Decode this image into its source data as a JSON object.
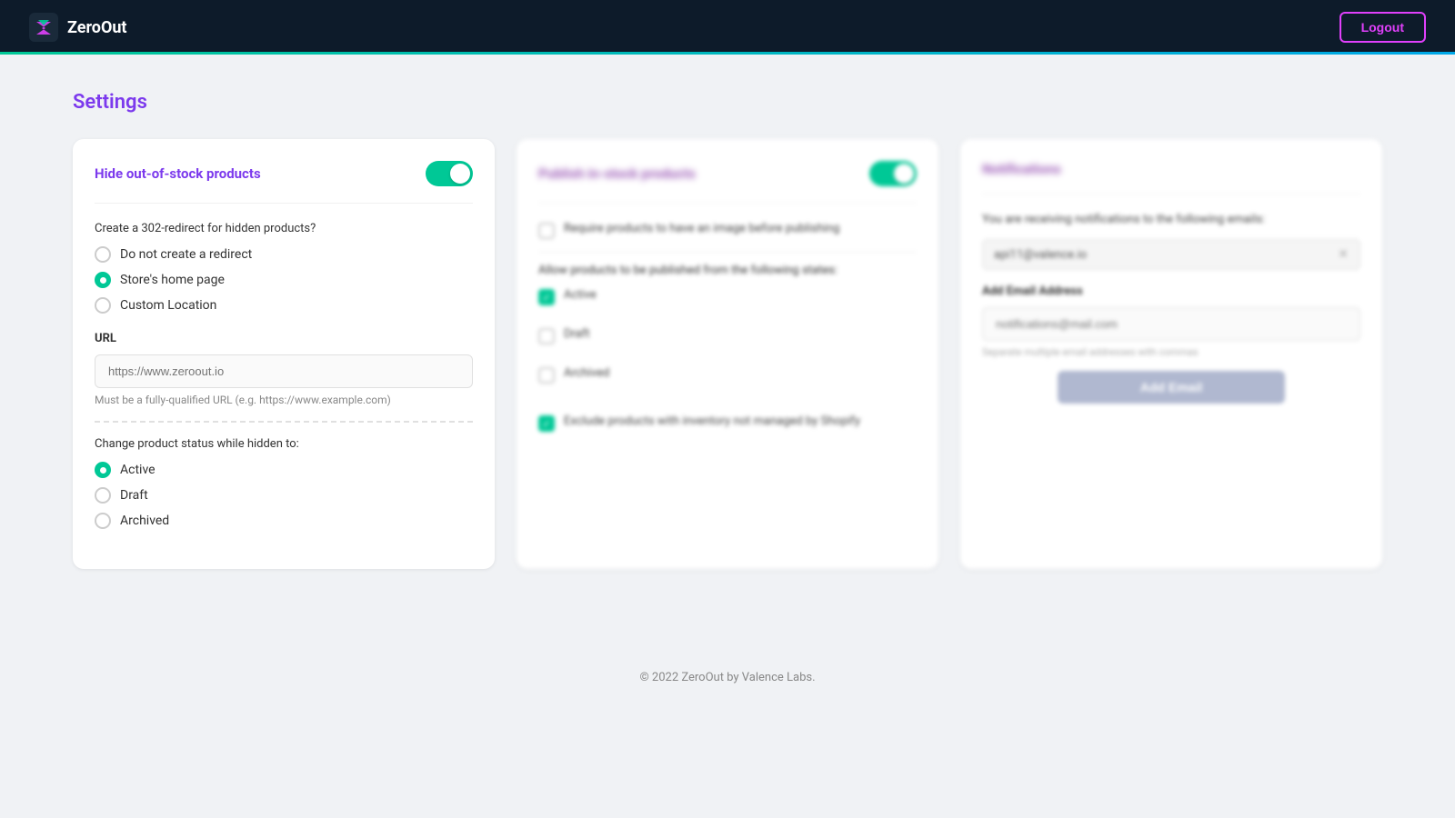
{
  "header": {
    "logo_text": "ZeroOut",
    "logout_label": "Logout"
  },
  "page": {
    "title": "Settings"
  },
  "card1": {
    "title": "Hide out-of-stock products",
    "toggle_on": true,
    "redirect_question": "Create a 302-redirect for hidden products?",
    "redirect_options": [
      {
        "label": "Do not create a redirect",
        "selected": false
      },
      {
        "label": "Store's home page",
        "selected": true
      },
      {
        "label": "Custom Location",
        "selected": false
      }
    ],
    "url_label": "URL",
    "url_placeholder": "https://www.zeroout.io",
    "url_hint": "Must be a fully-qualified URL (e.g. https://www.example.com)",
    "status_question": "Change product status while hidden to:",
    "status_options": [
      {
        "label": "Active",
        "selected": true
      },
      {
        "label": "Draft",
        "selected": false
      },
      {
        "label": "Archived",
        "selected": false
      }
    ]
  },
  "card2": {
    "title": "Publish in-stock products",
    "toggle_on": true,
    "require_image_label": "Require products to have an image before publishing",
    "publish_from_label": "Allow products to be published from the following states:",
    "states": [
      {
        "label": "Active",
        "checked": true
      },
      {
        "label": "Draft",
        "checked": false
      },
      {
        "label": "Archived",
        "checked": false
      }
    ],
    "exclude_label": "Exclude products with inventory not managed by Shopify",
    "exclude_checked": true
  },
  "card3": {
    "title": "Notifications",
    "toggle_on": true,
    "receiving_text": "You are receiving notifications to the following emails:",
    "existing_email": "api11@valence.io",
    "add_email_label": "Add Email Address",
    "add_email_placeholder": "notifications@mail.com",
    "add_email_hint": "Separate multiple email addresses with commas",
    "add_email_btn_label": "Add Email"
  },
  "footer": {
    "text": "© 2022 ZeroOut by Valence Labs."
  }
}
